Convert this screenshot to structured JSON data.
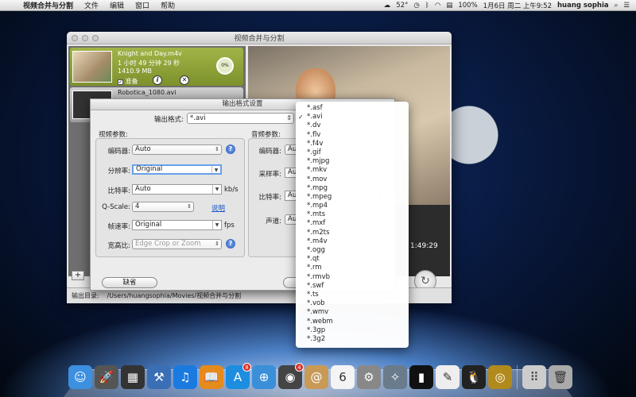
{
  "menubar": {
    "app_name": "视频合并与分割",
    "items": [
      "文件",
      "编辑",
      "窗口",
      "帮助"
    ],
    "temp": "52°",
    "battery": "100%",
    "date": "1月6日 周二 上午9:52",
    "user": "huang sophia"
  },
  "window": {
    "title": "视频合并与分割",
    "output_label": "输出目录:",
    "output_path": "/Users/huangsophia/Movies/视频合并与分割",
    "time": "1:49:29"
  },
  "files": [
    {
      "name": "Knight and Day.m4v",
      "duration": "1 小时 49 分钟 29 秒",
      "size": "1410.9 MB",
      "ready_label": "准备",
      "progress": "0%"
    },
    {
      "name": "Robotica_1080.avi"
    }
  ],
  "sheet": {
    "title": "输出格式设置",
    "format_label": "输出格式:",
    "format_value": "*.avi",
    "video": {
      "group_label": "视频参数:",
      "codec_label": "编码器:",
      "codec_value": "Auto",
      "resolution_label": "分辨率:",
      "resolution_value": "Original",
      "bitrate_label": "比特率:",
      "bitrate_value": "Auto",
      "bitrate_unit": "kb/s",
      "qscale_label": "Q-Scale:",
      "qscale_value": "4",
      "qscale_link": "说明",
      "fps_label": "帧速率:",
      "fps_value": "Original",
      "fps_unit": "fps",
      "aspect_label": "宽高比:",
      "aspect_value": "Edge Crop or Zoom"
    },
    "audio": {
      "group_label": "音频参数:",
      "codec_label": "编码器:",
      "codec_value": "Auto",
      "samplerate_label": "采样率:",
      "samplerate_value": "Auto",
      "bitrate_label": "比特率:",
      "bitrate_value": "Auto",
      "channels_label": "声道:",
      "channels_value": "Auto"
    },
    "default_button": "缺省"
  },
  "formats": [
    "*.asf",
    "*.avi",
    "*.dv",
    "*.flv",
    "*.f4v",
    "*.gif",
    "*.mjpg",
    "*.mkv",
    "*.mov",
    "*.mpg",
    "*.mpeg",
    "*.mp4",
    "*.mts",
    "*.mxf",
    "*.m2ts",
    "*.m4v",
    "*.ogg",
    "*.qt",
    "*.rm",
    "*.rmvb",
    "*.swf",
    "*.ts",
    "*.vob",
    "*.wmv",
    "*.webm",
    "*.3gp",
    "*.3g2"
  ],
  "selected_format_index": 1,
  "dock": [
    {
      "name": "finder-icon",
      "color": "#3d8fe0",
      "glyph": "☺"
    },
    {
      "name": "launchpad-icon",
      "color": "#555",
      "glyph": "🚀"
    },
    {
      "name": "mission-control-icon",
      "color": "#333",
      "glyph": "▦"
    },
    {
      "name": "xcode-icon",
      "color": "#3a6fb5",
      "glyph": "⚒"
    },
    {
      "name": "itunes-icon",
      "color": "#1a7ae0",
      "glyph": "♫"
    },
    {
      "name": "ibooks-icon",
      "color": "#e58a1c",
      "glyph": "📖"
    },
    {
      "name": "app-store-icon",
      "color": "#1d8de0",
      "glyph": "A",
      "badge": "8"
    },
    {
      "name": "safari-icon",
      "color": "#3a8fd8",
      "glyph": "⊕"
    },
    {
      "name": "photo-booth-icon",
      "color": "#444",
      "glyph": "◉",
      "badge": "4"
    },
    {
      "name": "contacts-icon",
      "color": "#c89a56",
      "glyph": "@"
    },
    {
      "name": "calendar-icon",
      "color": "#f4f4f4",
      "glyph": "6"
    },
    {
      "name": "system-preferences-icon",
      "color": "#888",
      "glyph": "⚙"
    },
    {
      "name": "utility-icon",
      "color": "#6a7b8c",
      "glyph": "✧"
    },
    {
      "name": "terminal-icon",
      "color": "#111",
      "glyph": "▮"
    },
    {
      "name": "textedit-icon",
      "color": "#eee",
      "glyph": "✎"
    },
    {
      "name": "qq-icon",
      "color": "#222",
      "glyph": "🐧"
    },
    {
      "name": "video-app-icon",
      "color": "#b08a1c",
      "glyph": "◎"
    },
    {
      "name": "downloads-stack-icon",
      "color": "#ccc",
      "glyph": "⠿"
    },
    {
      "name": "trash-icon",
      "color": "#aaa",
      "glyph": "🗑"
    }
  ]
}
